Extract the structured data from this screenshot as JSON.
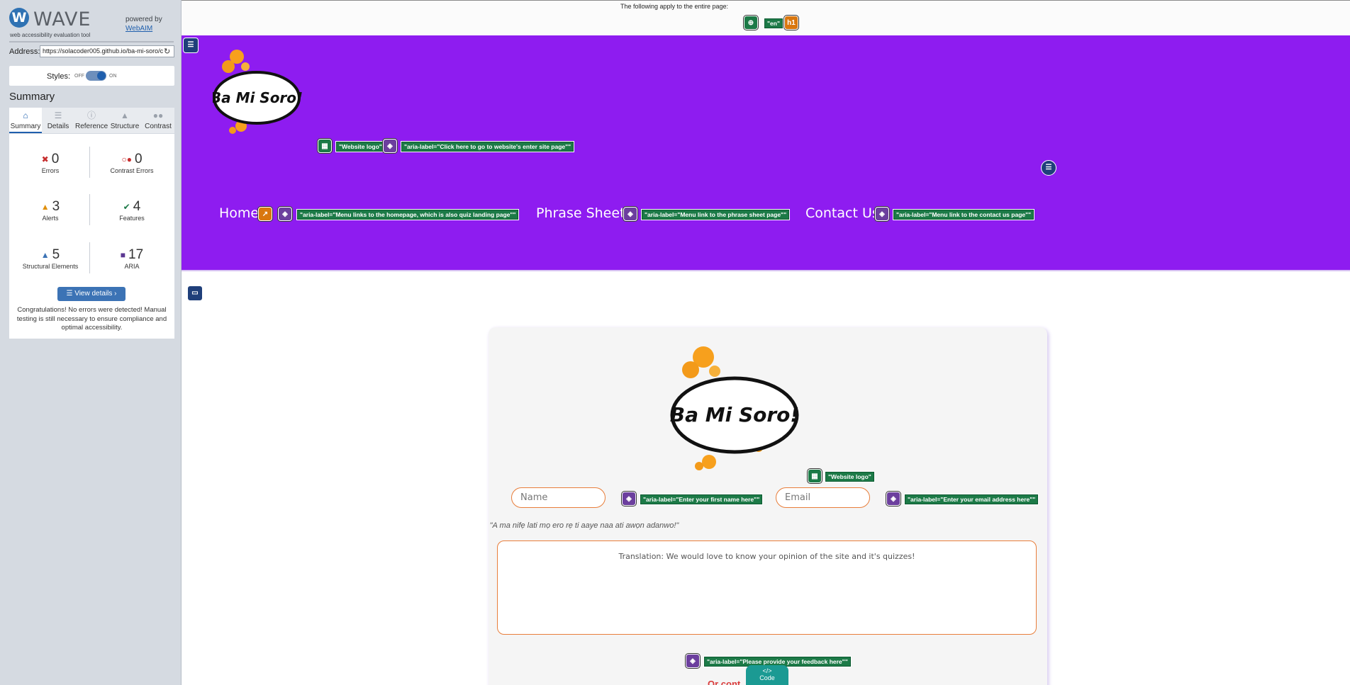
{
  "wave": {
    "logo_letter": "W",
    "title": "WAVE",
    "tagline": "web accessibility evaluation tool",
    "powered_by": "powered by",
    "webaim": "WebAIM",
    "address_label": "Address:",
    "address_value": "https://solacoder005.github.io/ba-mi-soro/c",
    "styles_label": "Styles:",
    "styles_off": "OFF",
    "styles_on": "ON",
    "summary_heading": "Summary",
    "tabs": [
      {
        "label": "Summary",
        "icon": "home-icon",
        "active": true
      },
      {
        "label": "Details",
        "icon": "list-icon",
        "active": false
      },
      {
        "label": "Reference",
        "icon": "info-icon",
        "active": false
      },
      {
        "label": "Structure",
        "icon": "structure-icon",
        "active": false
      },
      {
        "label": "Contrast",
        "icon": "contrast-icon",
        "active": false
      }
    ],
    "stats": {
      "errors": {
        "count": "0",
        "label": "Errors",
        "color": "#c62d2d"
      },
      "contrast_errors": {
        "count": "0",
        "label": "Contrast Errors",
        "color": "#c62d2d"
      },
      "alerts": {
        "count": "3",
        "label": "Alerts",
        "color": "#e0900e"
      },
      "features": {
        "count": "4",
        "label": "Features",
        "color": "#1c7a47"
      },
      "structural": {
        "count": "5",
        "label": "Structural Elements",
        "color": "#3c73b5"
      },
      "aria": {
        "count": "17",
        "label": "ARIA",
        "color": "#5b3792"
      }
    },
    "view_details": "View details ›",
    "congrats": "Congratulations! No errors were detected! Manual testing is still necessary to ensure compliance and optimal accessibility."
  },
  "page_top": {
    "notice": "The following apply to the entire page:",
    "lang_tag": "\"en\"",
    "h1_icon": "h1"
  },
  "header": {
    "logo_text": "Ba Mi Soro!",
    "logo_alt_tag": "\"Website logo\"",
    "logo_aria_tag": "\"aria-label=\"Click here to go to website's enter site page\"\"",
    "nav": [
      {
        "label": "Home",
        "aria": "\"aria-label=\"Menu links to the homepage, which is also quiz landing page\"\""
      },
      {
        "label": "Phrase Sheets",
        "aria": "\"aria-label=\"Menu link to the phrase sheet page\"\""
      },
      {
        "label": "Contact Us",
        "aria": "\"aria-label=\"Menu link to the contact us page\"\""
      }
    ]
  },
  "form": {
    "logo_text": "Ba Mi Soro!",
    "logo_alt_tag": "\"Website logo\"",
    "name_placeholder": "Name",
    "name_aria": "\"aria-label=\"Enter your first name here\"\"",
    "email_placeholder": "Email",
    "email_aria": "\"aria-label=\"Enter your email address here\"\"",
    "quote": "\"A ma nifẹ lati mọ ero rẹ ti aaye naa ati awọn adanwo!\"",
    "feedback_text": "Translation: We would love to know your opinion of the site and it's quizzes!",
    "feedback_aria": "\"aria-label=\"Please provide your feedback here\"\"",
    "code_label": "Code",
    "or_contact": "Or cont"
  }
}
